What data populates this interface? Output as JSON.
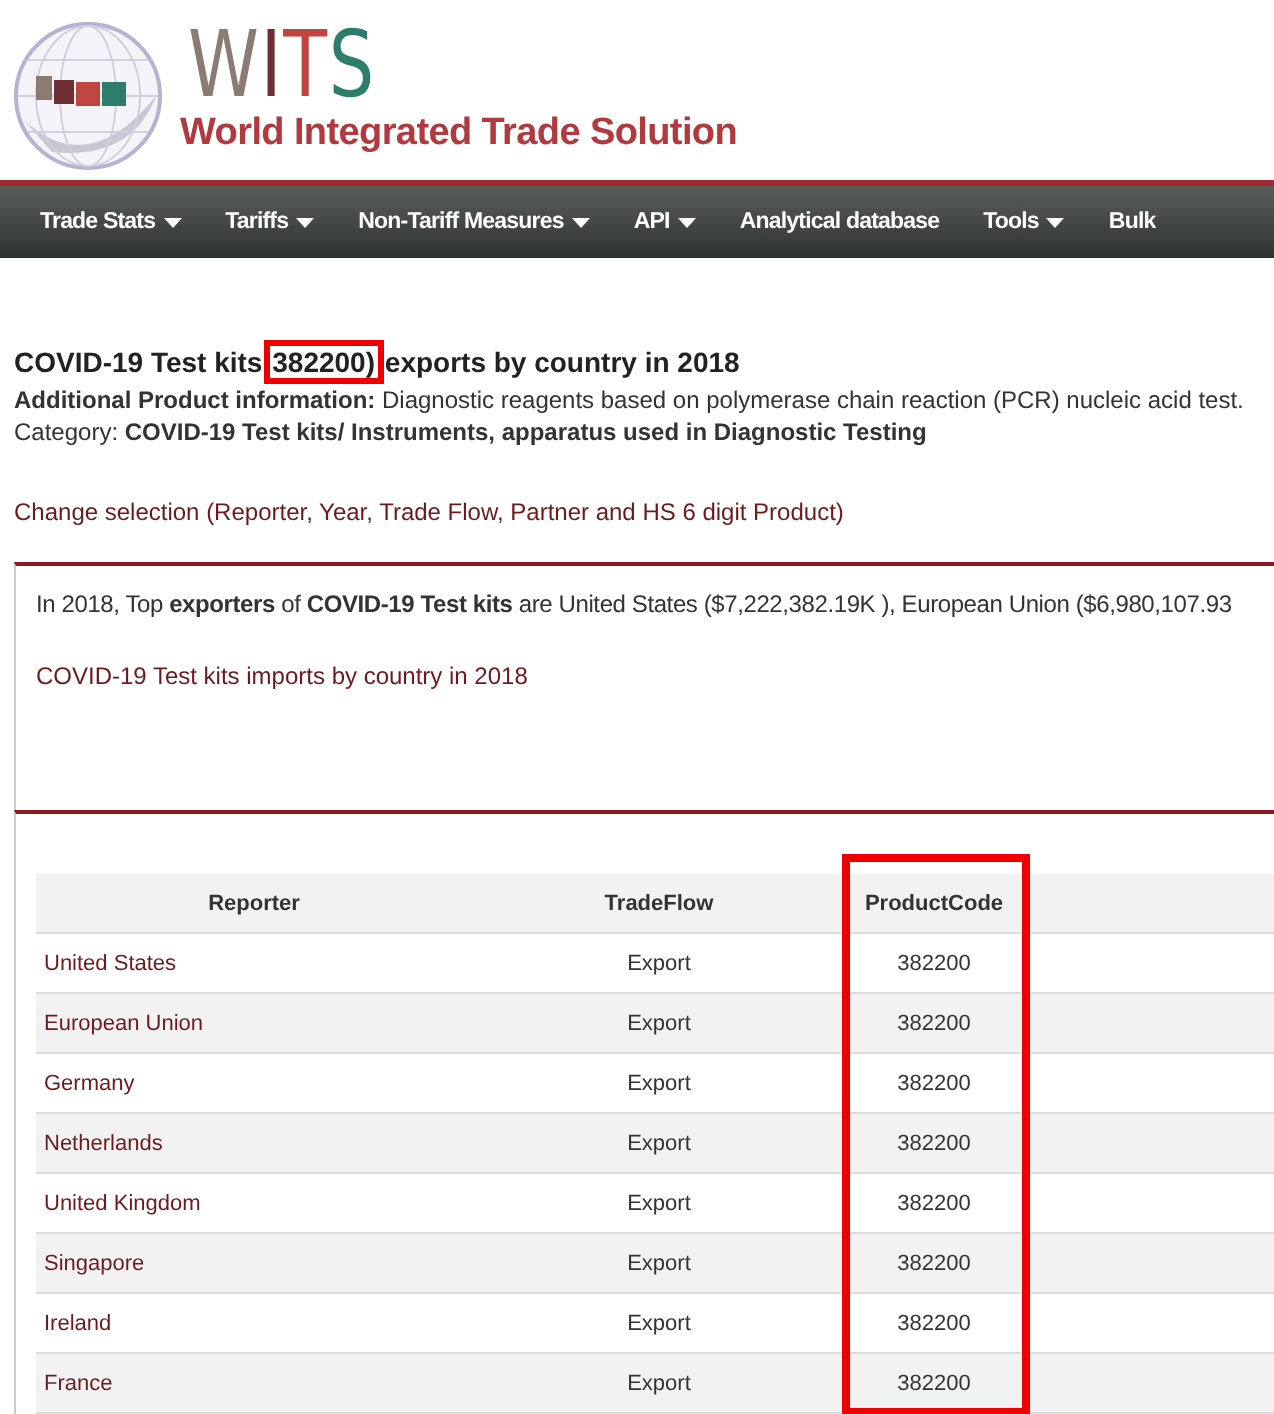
{
  "logo": {
    "letters": [
      "W",
      "I",
      "T",
      "S"
    ],
    "subtitle": "World Integrated Trade Solution"
  },
  "nav": [
    {
      "label": "Trade Stats",
      "dropdown": true
    },
    {
      "label": "Tariffs",
      "dropdown": true
    },
    {
      "label": "Non-Tariff Measures",
      "dropdown": true
    },
    {
      "label": "API",
      "dropdown": true
    },
    {
      "label": "Analytical database",
      "dropdown": false
    },
    {
      "label": "Tools",
      "dropdown": true
    },
    {
      "label": "Bulk",
      "dropdown": false
    }
  ],
  "heading": {
    "before": "COVID-19 Test kits ",
    "code": "382200)",
    "after": " exports by country in 2018",
    "code_highlighted": true
  },
  "product_info": "**Additional Product information:** Diagnostic reagents based on polymerase chain reaction (PCR) nucleic acid test.",
  "category": "Category: **COVID-19 Test kits/ Instruments, apparatus used in Diagnostic Testing**",
  "change_link": "Change selection (Reporter, Year, Trade Flow, Partner and HS 6 digit Product)",
  "summary": {
    "text": "In 2018, Top **exporters** of **COVID-19 Test kits** are United States ($7,222,382.19K ), European Union ($6,980,107.93",
    "link": "COVID-19 Test kits imports by country in 2018"
  },
  "table": {
    "columns": [
      {
        "label": "Reporter",
        "highlighted": false
      },
      {
        "label": "TradeFlow",
        "highlighted": false
      },
      {
        "label": "ProductCode",
        "highlighted": true
      }
    ],
    "rows": [
      [
        "United States",
        "Export",
        "382200"
      ],
      [
        "European Union",
        "Export",
        "382200"
      ],
      [
        "Germany",
        "Export",
        "382200"
      ],
      [
        "Netherlands",
        "Export",
        "382200"
      ],
      [
        "United Kingdom",
        "Export",
        "382200"
      ],
      [
        "Singapore",
        "Export",
        "382200"
      ],
      [
        "Ireland",
        "Export",
        "382200"
      ],
      [
        "France",
        "Export",
        "382200"
      ]
    ]
  }
}
